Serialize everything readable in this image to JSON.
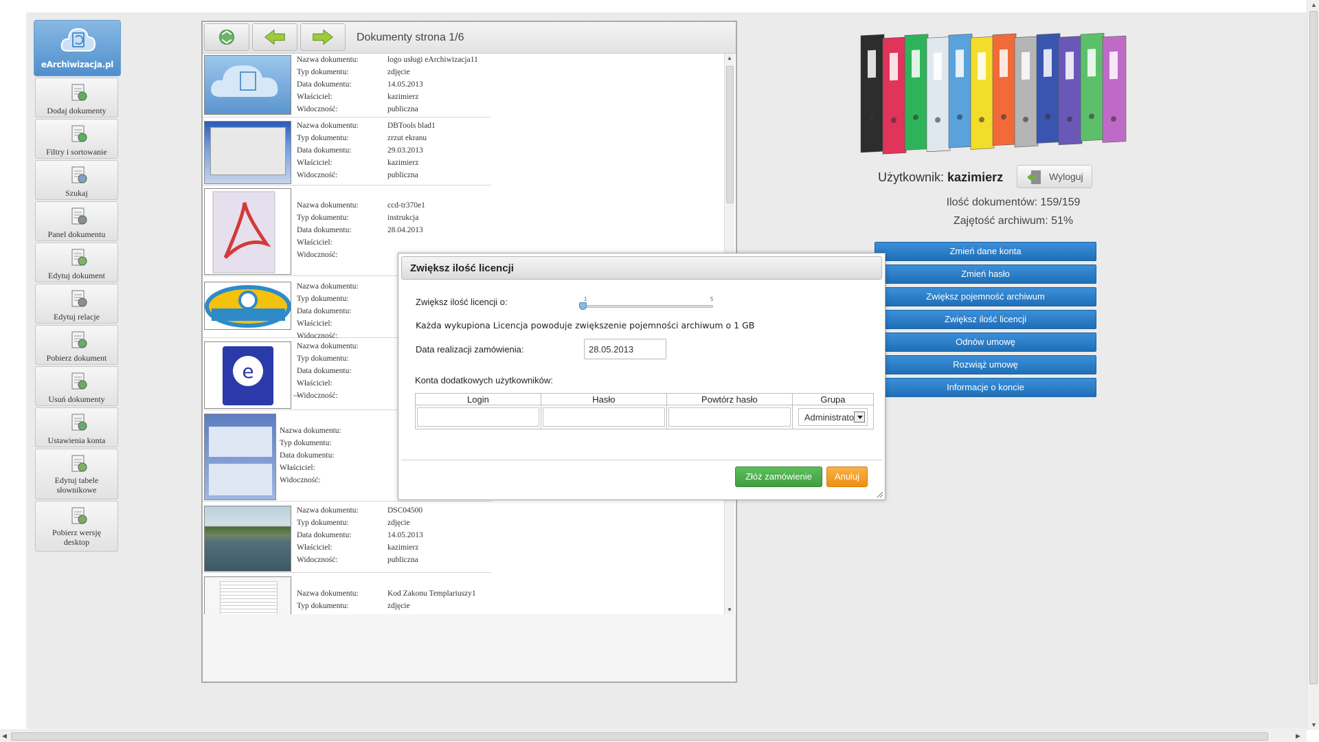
{
  "app": {
    "logo_text": "eArchiwizacja.pl"
  },
  "sidebar": {
    "items": [
      {
        "label": "Dodaj dokumenty",
        "icon": "add-document-icon"
      },
      {
        "label": "Filtry i sortowanie",
        "icon": "filter-icon"
      },
      {
        "label": "Szukaj",
        "icon": "search-icon"
      },
      {
        "label": "Panel dokumentu",
        "icon": "document-panel-icon"
      },
      {
        "label": "Edytuj dokument",
        "icon": "edit-document-icon"
      },
      {
        "label": "Edytuj relacje",
        "icon": "paperclip-icon"
      },
      {
        "label": "Pobierz dokument",
        "icon": "download-icon"
      },
      {
        "label": "Usuń dokumenty",
        "icon": "delete-icon"
      },
      {
        "label": "Ustawienia konta",
        "icon": "settings-icon"
      },
      {
        "label": "Edytuj tabele słownikowe",
        "icon": "dictionary-icon"
      },
      {
        "label": "Pobierz wersję desktop",
        "icon": "desktop-download-icon"
      }
    ]
  },
  "docs": {
    "title": "Dokumenty strona 1/6",
    "field_labels": {
      "name": "Nazwa dokumentu:",
      "type": "Typ dokumentu:",
      "date": "Data dokumentu:",
      "owner": "Właściciel:",
      "visibility": "Widoczność:"
    },
    "rows": [
      {
        "name": "logo usługi eArchiwizacja11",
        "type": "zdjęcie",
        "date": "14.05.2013",
        "owner": "kazimierz",
        "visibility": "publiczna"
      },
      {
        "name": "DBTools blad1",
        "type": "zrzut ekranu",
        "date": "29.03.2013",
        "owner": "kazimierz",
        "visibility": "publiczna"
      },
      {
        "name": "ccd-tr370e1",
        "type": "instrukcja",
        "date": "28.04.2013",
        "owner": "",
        "visibility": ""
      },
      {
        "name": "",
        "type": "",
        "date": "",
        "owner": "",
        "visibility": ""
      },
      {
        "name": "",
        "type": "",
        "date": "",
        "owner": "",
        "visibility": "",
        "extra": "--"
      },
      {
        "name": "",
        "type": "",
        "date": "",
        "owner": "",
        "visibility": ""
      },
      {
        "name": "DSC04500",
        "type": "zdjęcie",
        "date": "14.05.2013",
        "owner": "kazimierz",
        "visibility": "publiczna"
      },
      {
        "name": "Kod Zakonu Templariuszy1",
        "type": "zdjęcie"
      }
    ]
  },
  "user": {
    "label": "Użytkownik:",
    "name": "kazimierz",
    "logout": "Wyloguj",
    "docs_count": "Ilość dokumentów: 159/159",
    "archive_usage": "Zajętość archiwum: 51%"
  },
  "actions": [
    "Zmień dane konta",
    "Zmień hasło",
    "Zwiększ pojemność archiwum",
    "Zwiększ ilość licencji",
    "Odnów umowę",
    "Rozwiąż umowę",
    "Informacje o koncie"
  ],
  "modal": {
    "title": "Zwiększ ilość licencji",
    "increase_label": "Zwiększ ilość licencji o:",
    "slider_min": "1",
    "slider_max": "5",
    "slider_value": 1,
    "info": "Każda wykupiona Licencja powoduje zwiększenie pojemności archiwum o 1 GB",
    "date_label": "Data realizacji zamówienia:",
    "date_value": "28.05.2013",
    "users_label": "Konta dodatkowych użytkowników:",
    "columns": [
      "Login",
      "Hasło",
      "Powtórz hasło",
      "Grupa"
    ],
    "group_value": "Administrators",
    "submit": "Złóż zamówienie",
    "cancel": "Anuluj"
  },
  "colors": {
    "action_blue": "#2a7cc6",
    "submit_green": "#4cae4c",
    "cancel_orange": "#f0a030"
  }
}
